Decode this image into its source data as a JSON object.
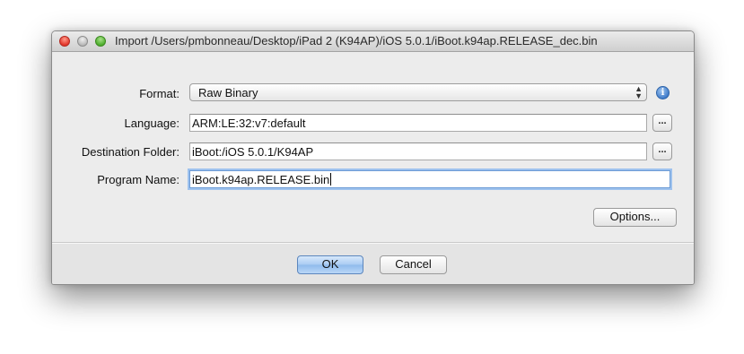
{
  "window": {
    "title": "Import /Users/pmbonneau/Desktop/iPad 2 (K94AP)/iOS 5.0.1/iBoot.k94ap.RELEASE_dec.bin"
  },
  "form": {
    "format": {
      "label": "Format:",
      "value": "Raw Binary",
      "info_icon": "info-icon"
    },
    "language": {
      "label": "Language:",
      "value": "ARM:LE:32:v7:default",
      "browse_label": "..."
    },
    "destination": {
      "label": "Destination Folder:",
      "value": "iBoot:/iOS 5.0.1/K94AP",
      "browse_label": "..."
    },
    "program_name": {
      "label": "Program Name:",
      "value": "iBoot.k94ap.RELEASE.bin"
    },
    "options_label": "Options..."
  },
  "footer": {
    "ok_label": "OK",
    "cancel_label": "Cancel"
  },
  "colors": {
    "focus_ring": "#9ec2ee",
    "default_button": "#a9cbf2",
    "close_button": "#e3372b",
    "zoom_button": "#4fae2e"
  }
}
